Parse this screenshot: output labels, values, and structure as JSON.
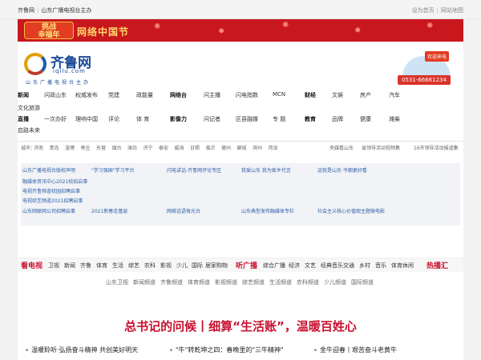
{
  "topbar": {
    "site": "齐鲁网",
    "sub": "山东广播电视台主办",
    "homepage": "设为首页",
    "sitemap": "网站地图"
  },
  "banner": {
    "badge_line1": "挑战",
    "badge_line2": "幸福年",
    "title": "网络中国节"
  },
  "logo": {
    "name": "齐鲁网",
    "domain": "iqilu.com",
    "sub": "山东广播电视台主办"
  },
  "hotline": {
    "tag": "欢迎来电",
    "phone": "0531-66661234"
  },
  "nav_row1": [
    "新闻",
    "问政山东",
    "权威发布",
    "党建",
    "政能量",
    "网络台",
    "问主播",
    "闪电指数",
    "MCN",
    "财经",
    "文娱",
    "房产",
    "汽车"
  ],
  "nav_row1b": [
    "文化旅游"
  ],
  "nav_row2": [
    "直播",
    "一次办好",
    "理响中国",
    "评论",
    "体 育",
    "影像力",
    "问记者",
    "区县融媒",
    "专 题",
    "教育",
    "品牌",
    "健康",
    "潍柴"
  ],
  "nav_row2b": [
    "启路未来"
  ],
  "cities": {
    "label": "城市：",
    "items": [
      "济南",
      "青岛",
      "淄博",
      "枣庄",
      "东营",
      "烟台",
      "潍坊",
      "济宁",
      "泰安",
      "威海",
      "日照",
      "临沂",
      "德州",
      "聊城",
      "滨州",
      "菏泽"
    ],
    "right1": "央媒看山东",
    "right2": "省领导活动视频集",
    "right3": "16市领导活动报道集"
  },
  "links": [
    "山东广播电视台版权声明",
    "\"学习强国\"学习平台",
    "闪电讲话-齐鲁网评论专区",
    "我爱山东 我为家乡代言",
    "这就是山东·今朝更好看",
    "融媒体资讯中心2021校招启事",
    "电视齐鲁频道校园招聘启事",
    "电视综艺频道2021招聘启事",
    "山东网联网公司招聘启事",
    "2021新春走基层",
    "网络话语每光台",
    "山东典型发布融媒体专栏",
    "社会主义核心价值观主题微电影"
  ],
  "tvbar": {
    "label": "看电视",
    "items": [
      "卫视",
      "新闻",
      "齐鲁",
      "体育",
      "生活",
      "综艺",
      "农科",
      "影视",
      "少儿",
      "国际",
      "居家购物"
    ],
    "radio_label": "听广播",
    "radio_items": [
      "综合广播",
      "经济",
      "文艺",
      "经典音乐",
      "交通",
      "乡村",
      "音乐",
      "体育休闲"
    ],
    "hot_label": "热播汇"
  },
  "tvlinks": [
    "山东卫视",
    "新闻频道",
    "齐鲁频道",
    "体育频道",
    "影视频道",
    "综艺频道",
    "生活频道",
    "农科频道",
    "少儿频道",
    "国际频道"
  ],
  "headline": "总书记的问候丨细算“生活账”，温暖百姓心",
  "subnews": [
    "温暖聆听·弘扬奋斗精神 共创美好明天",
    "\"牛\"转乾坤之四：春晚里的\"三牛精神\"",
    "金牛迎春丨艰苦奋斗老黄牛"
  ]
}
